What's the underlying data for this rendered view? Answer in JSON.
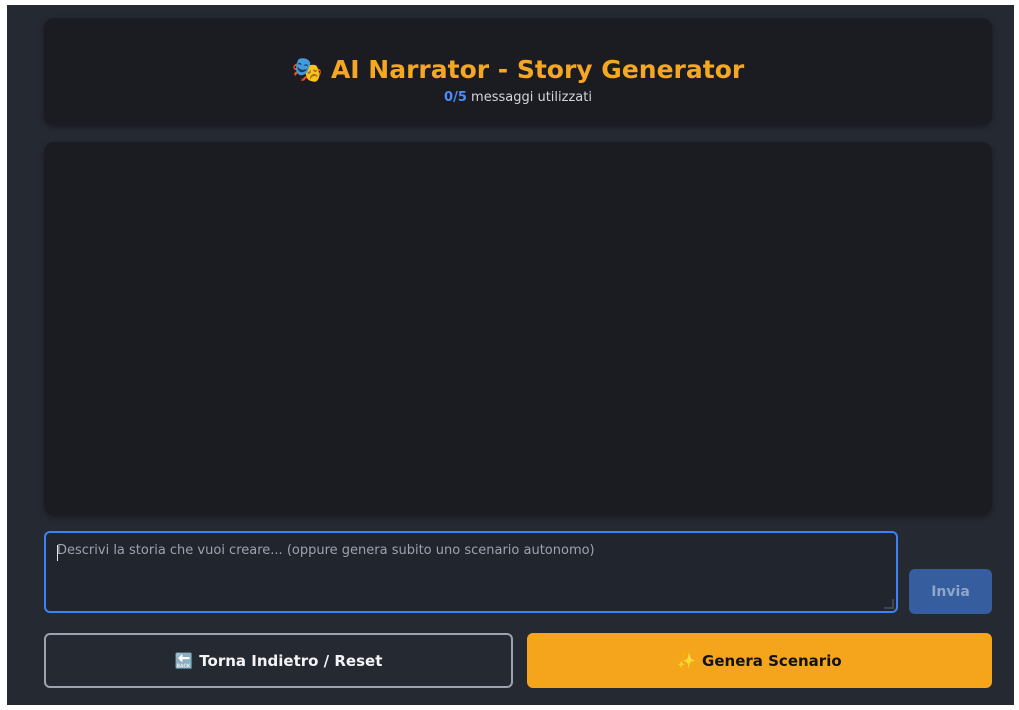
{
  "header": {
    "title_emoji": "🎭",
    "title": "AI Narrator - Story Generator",
    "counter_value": "0/5",
    "counter_label": "messaggi utilizzati"
  },
  "input": {
    "placeholder": "Descrivi la storia che vuoi creare... (oppure genera subito uno scenario autonomo)"
  },
  "buttons": {
    "send_label": "Invia",
    "back_icon": "🔙",
    "back_label": "Torna Indietro / Reset",
    "generate_icon": "✨",
    "generate_label": "Genera Scenario"
  },
  "colors": {
    "accent": "#f5a51c",
    "focus": "#3b82f6",
    "counter": "#4c8df6",
    "background": "#252932",
    "panel": "#1b1c21"
  }
}
